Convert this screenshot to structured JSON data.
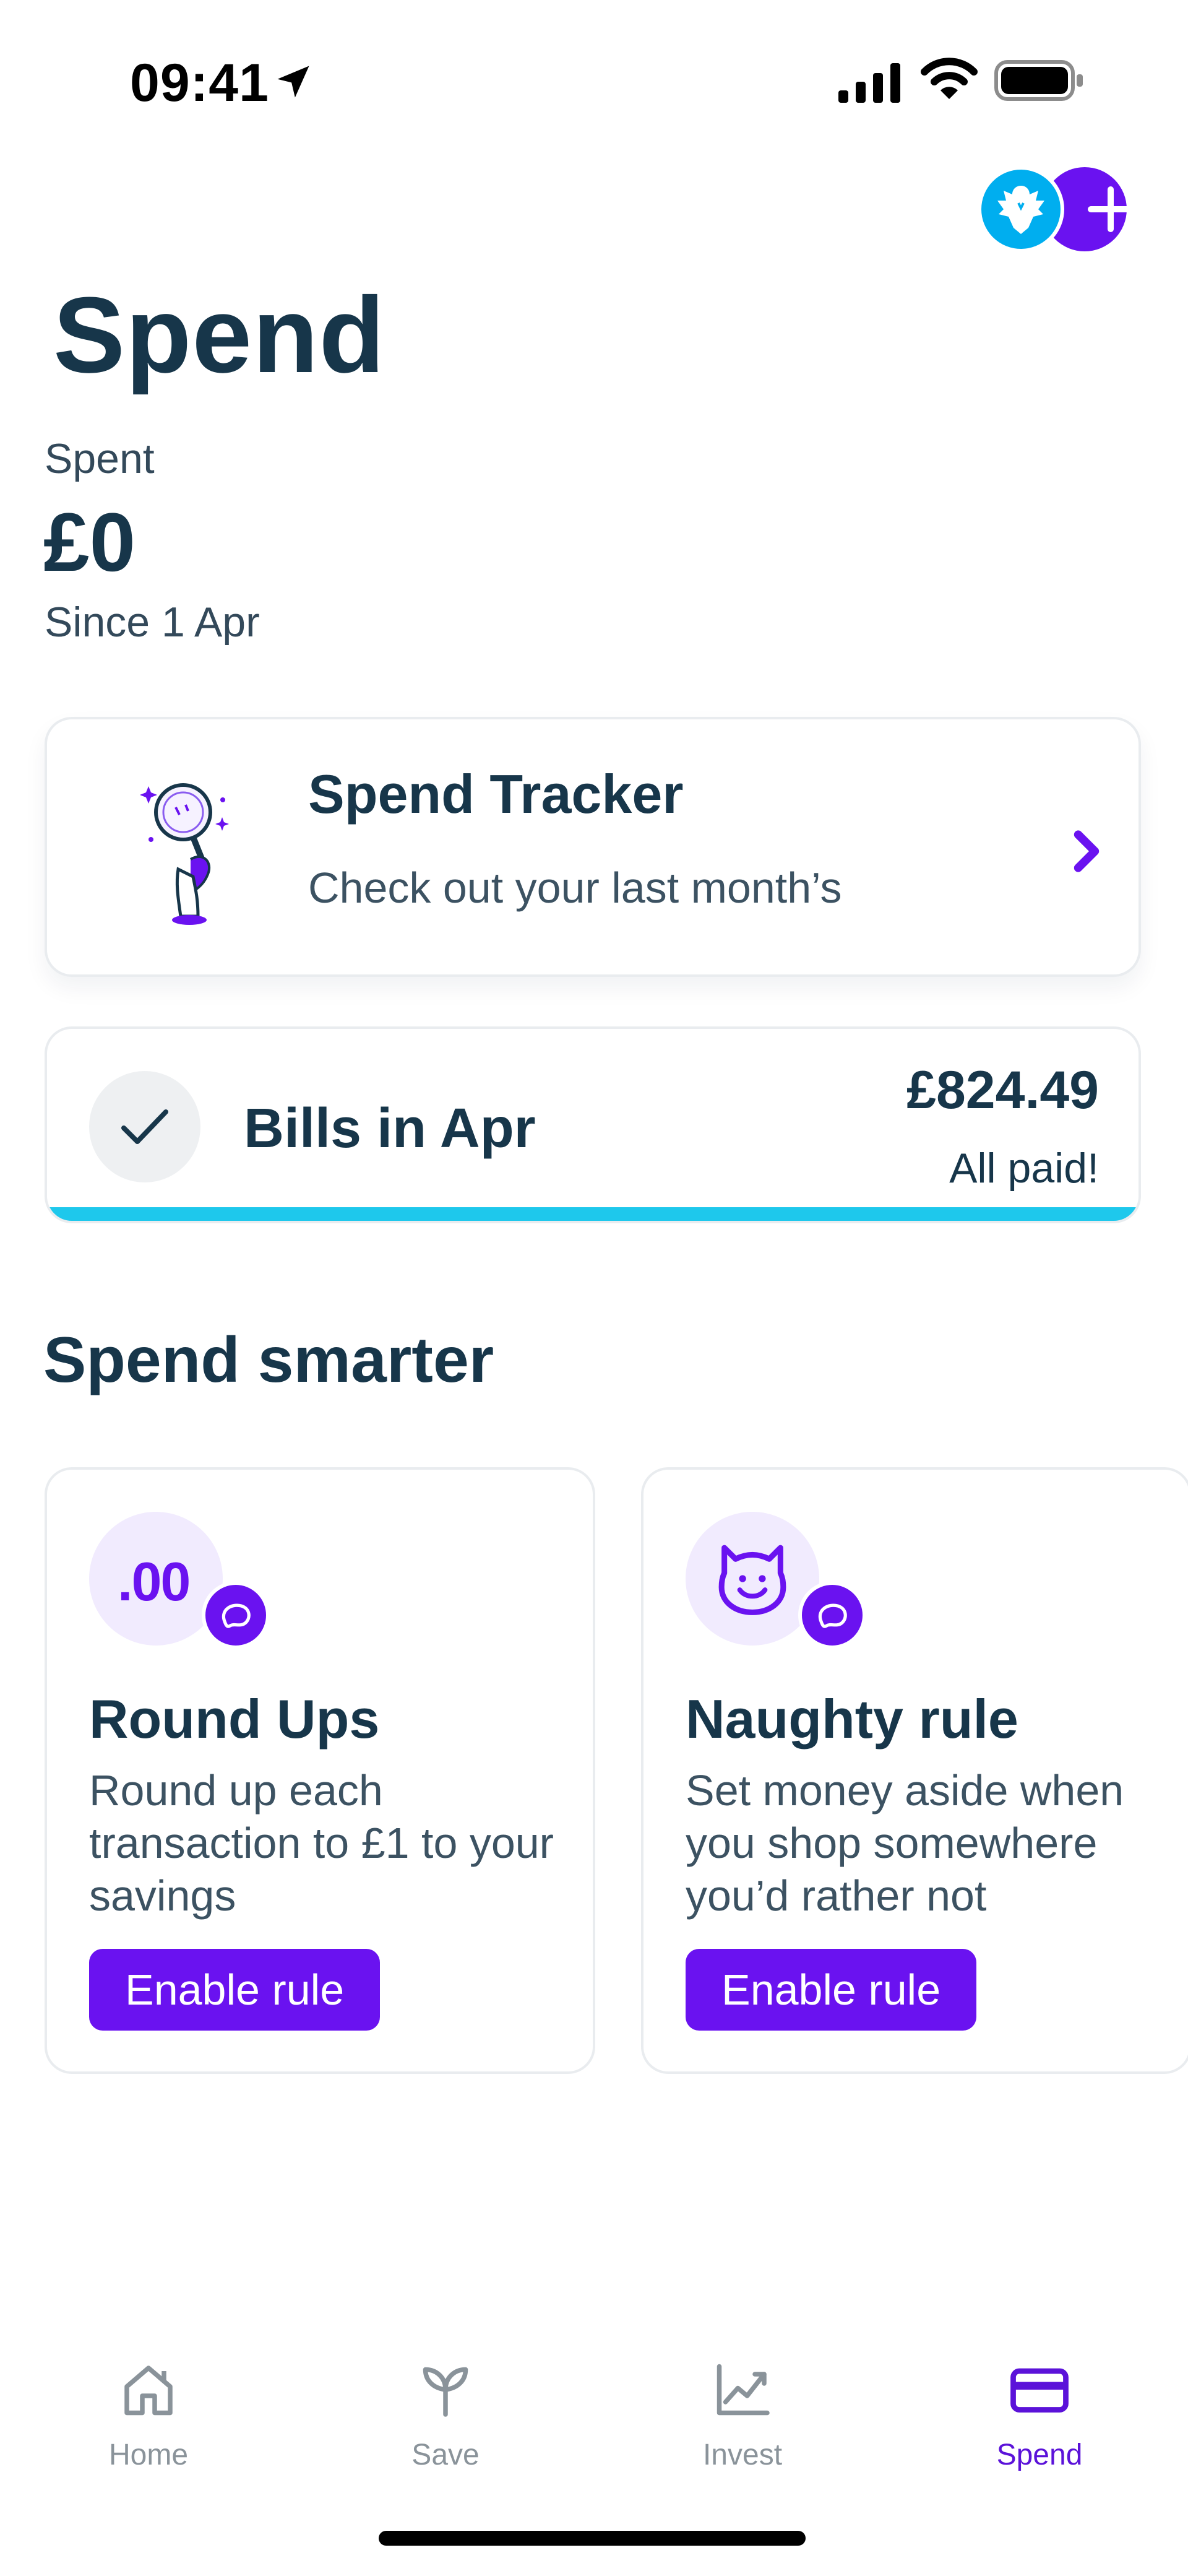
{
  "status_bar": {
    "time": "09:41",
    "icons": [
      "location-arrow-icon",
      "cellular-signal-icon",
      "wifi-icon",
      "battery-icon"
    ]
  },
  "header": {
    "title": "Spend",
    "avatars": [
      "barclays-eagle-icon",
      "plus-icon"
    ]
  },
  "summary": {
    "label": "Spent",
    "amount": "£0",
    "since": "Since 1 Apr"
  },
  "spend_tracker": {
    "title": "Spend Tracker",
    "subtitle": "Check out your last month’s",
    "icon": "magnifying-glass-illustration",
    "action_icon": "chevron-right-icon"
  },
  "bills": {
    "label": "Bills in Apr",
    "amount": "£824.49",
    "status": "All paid!",
    "progress": 1.0,
    "icon": "checkmark-icon"
  },
  "spend_smarter": {
    "heading": "Spend smarter",
    "cards": [
      {
        "icon_text": ".00",
        "title": "Round Ups",
        "description": "Round up each transaction to £1 to your savings",
        "button": "Enable rule"
      },
      {
        "icon": "devil-face-icon",
        "title": "Naughty rule",
        "description": "Set money aside when you shop somewhere you’d rather not",
        "button": "Enable rule"
      }
    ]
  },
  "tabs": [
    {
      "label": "Home",
      "icon": "home-icon",
      "active": false
    },
    {
      "label": "Save",
      "icon": "sprout-icon",
      "active": false
    },
    {
      "label": "Invest",
      "icon": "chart-line-icon",
      "active": false
    },
    {
      "label": "Spend",
      "icon": "card-icon",
      "active": true
    }
  ],
  "colors": {
    "accent": "#6a12f0",
    "text": "#17364a",
    "progress": "#1ec8ec",
    "bank_blue": "#00aeef"
  }
}
